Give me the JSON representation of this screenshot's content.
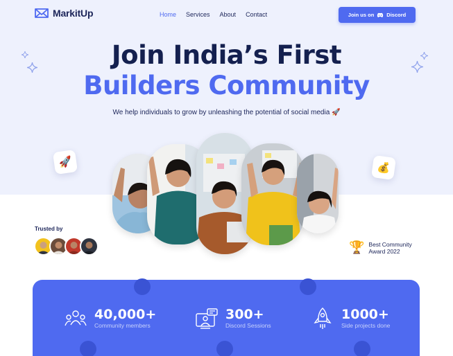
{
  "brand": {
    "name": "MarkitUp"
  },
  "nav": {
    "items": [
      "Home",
      "Services",
      "About",
      "Contact"
    ],
    "active": "Home"
  },
  "cta": {
    "label": "Join us on",
    "platform": "Discord"
  },
  "hero": {
    "line1": "Join India’s First",
    "line2": "Builders Community",
    "subtitle": "We help individuals to grow by unleashing the potential of social media 🚀"
  },
  "floating": {
    "left_emoji": "🚀",
    "right_emoji": "💰"
  },
  "trusted": {
    "label": "Trusted by"
  },
  "award": {
    "line1": "Best Community",
    "line2": "Award 2022",
    "emoji": "🏆"
  },
  "stats": [
    {
      "value": "40,000+",
      "label": "Community members"
    },
    {
      "value": "300+",
      "label": "Discord Sessions"
    },
    {
      "value": "1000+",
      "label": "Side projects done"
    }
  ],
  "colors": {
    "accent": "#4f6af0",
    "navy": "#14204f",
    "hero_bg": "#eef1fd"
  }
}
